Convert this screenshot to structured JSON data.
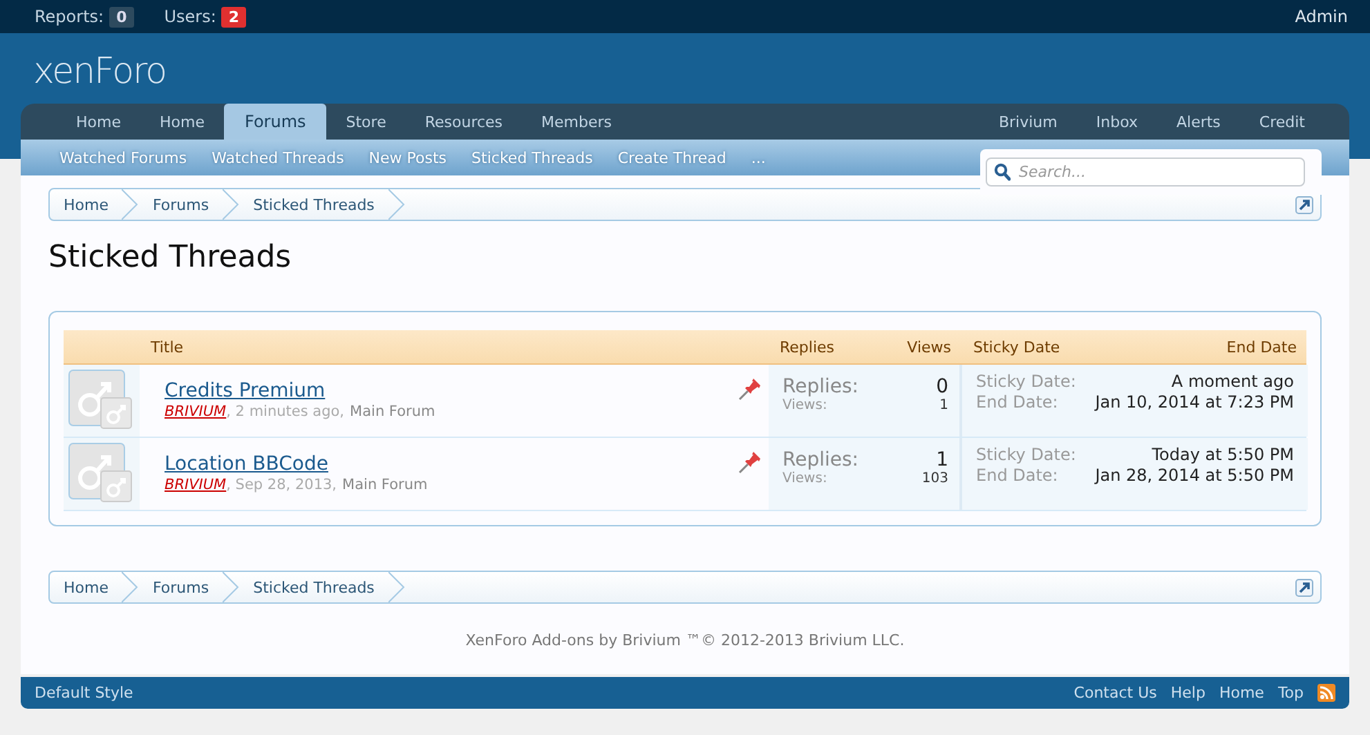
{
  "top_bar": {
    "counters": [
      {
        "label": "Reports:",
        "count": "0",
        "alert": false
      },
      {
        "label": "Users:",
        "count": "2",
        "alert": true
      }
    ],
    "user": "Admin"
  },
  "logo": "xenForo",
  "nav": {
    "tabs": [
      {
        "label": "Home",
        "selected": false
      },
      {
        "label": "Home",
        "selected": false
      },
      {
        "label": "Forums",
        "selected": true
      },
      {
        "label": "Store",
        "selected": false
      },
      {
        "label": "Resources",
        "selected": false
      },
      {
        "label": "Members",
        "selected": false
      }
    ],
    "right_tabs": [
      "Brivium",
      "Inbox",
      "Alerts",
      "Credit"
    ],
    "sub_links": [
      "Watched Forums",
      "Watched Threads",
      "New Posts",
      "Sticked Threads",
      "Create Thread",
      "..."
    ]
  },
  "search": {
    "placeholder": "Search..."
  },
  "breadcrumbs_top": [
    "Home",
    "Forums",
    "Sticked Threads"
  ],
  "title": "Sticked Threads",
  "table": {
    "columns": [
      "Title",
      "Replies",
      "Views",
      "Sticky Date",
      "End Date"
    ],
    "rows": [
      {
        "title": "Credits Premium",
        "author": "BRIVIUM",
        "time": ", 2 minutes ago,",
        "forum": "Main Forum",
        "sticky": true,
        "replies_label": "Replies:",
        "replies": "0",
        "views_label": "Views:",
        "views": "1",
        "sticky_label": "Sticky Date:",
        "sticky_date": "A moment ago",
        "end_label": "End Date:",
        "end_date": "Jan 10, 2014 at 7:23 PM"
      },
      {
        "title": "Location BBCode",
        "author": "BRIVIUM",
        "time": ", Sep 28, 2013,",
        "forum": "Main Forum",
        "sticky": true,
        "replies_label": "Replies:",
        "replies": "1",
        "views_label": "Views:",
        "views": "103",
        "sticky_label": "Sticky Date:",
        "sticky_date": "Today at 5:50 PM",
        "end_label": "End Date:",
        "end_date": "Jan 28, 2014 at 5:50 PM"
      }
    ]
  },
  "breadcrumbs_bottom": [
    "Home",
    "Forums",
    "Sticked Threads"
  ],
  "copyright": "XenForo Add-ons by Brivium ™© 2012-2013 Brivium LLC.",
  "footer_bar": {
    "style": "Default Style",
    "links": [
      "Contact Us",
      "Help",
      "Home",
      "Top"
    ]
  }
}
